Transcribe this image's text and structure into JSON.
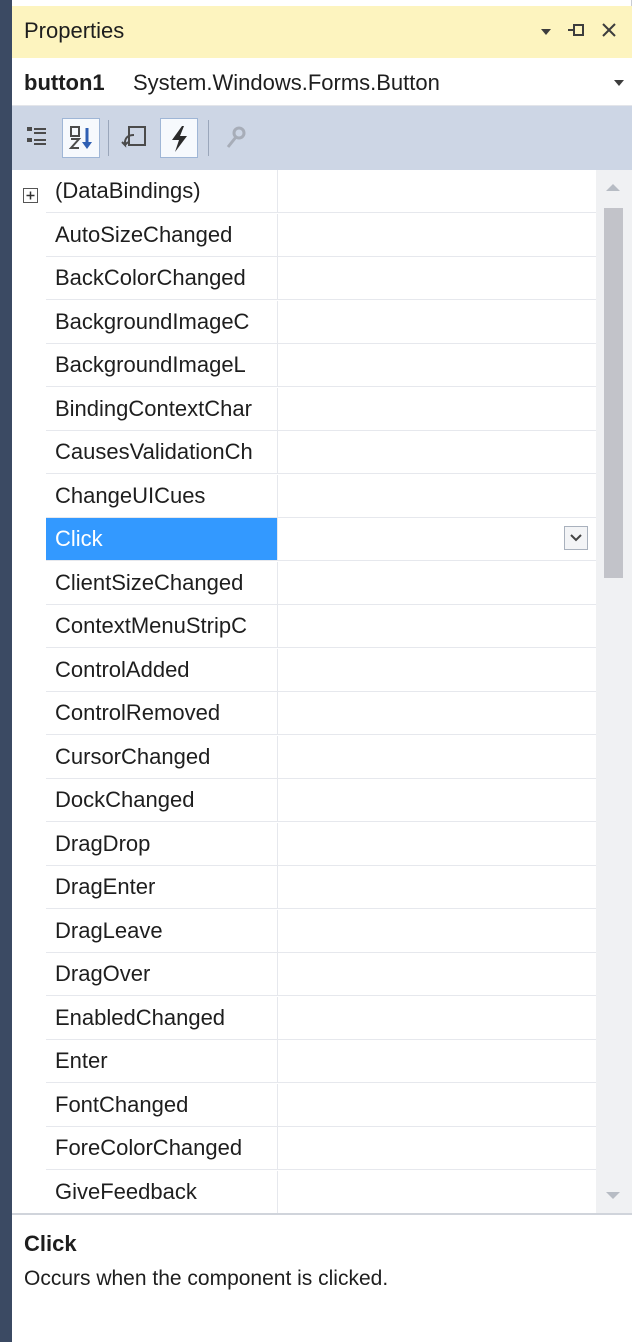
{
  "window": {
    "title": "Properties",
    "icons": [
      "dropdown-icon",
      "pin-icon",
      "close-icon"
    ]
  },
  "object_selector": {
    "name": "button1",
    "type": "System.Windows.Forms.Button"
  },
  "toolbar": {
    "buttons": [
      {
        "name": "categorized-icon",
        "active": false
      },
      {
        "name": "alphabetical-icon",
        "active": true
      },
      {
        "name": "properties-icon",
        "active": false
      },
      {
        "name": "events-icon",
        "active": true
      },
      {
        "name": "property-pages-icon",
        "active": false,
        "disabled": true
      }
    ]
  },
  "grid": {
    "rows": [
      {
        "label": "(DataBindings)",
        "expandable": true
      },
      {
        "label": "AutoSizeChanged"
      },
      {
        "label": "BackColorChanged"
      },
      {
        "label": "BackgroundImageC"
      },
      {
        "label": "BackgroundImageL"
      },
      {
        "label": "BindingContextChar"
      },
      {
        "label": "CausesValidationCh"
      },
      {
        "label": "ChangeUICues"
      },
      {
        "label": "Click",
        "selected": true
      },
      {
        "label": "ClientSizeChanged"
      },
      {
        "label": "ContextMenuStripC"
      },
      {
        "label": "ControlAdded"
      },
      {
        "label": "ControlRemoved"
      },
      {
        "label": "CursorChanged"
      },
      {
        "label": "DockChanged"
      },
      {
        "label": "DragDrop"
      },
      {
        "label": "DragEnter"
      },
      {
        "label": "DragLeave"
      },
      {
        "label": "DragOver"
      },
      {
        "label": "EnabledChanged"
      },
      {
        "label": "Enter"
      },
      {
        "label": "FontChanged"
      },
      {
        "label": "ForeColorChanged"
      },
      {
        "label": "GiveFeedback"
      }
    ]
  },
  "description": {
    "title": "Click",
    "text": "Occurs when the component is clicked."
  },
  "colors": {
    "title_bar": "#fdf4bf",
    "toolbar": "#cdd6e5",
    "selection": "#3399ff",
    "left_edge": "#3b4a63"
  }
}
